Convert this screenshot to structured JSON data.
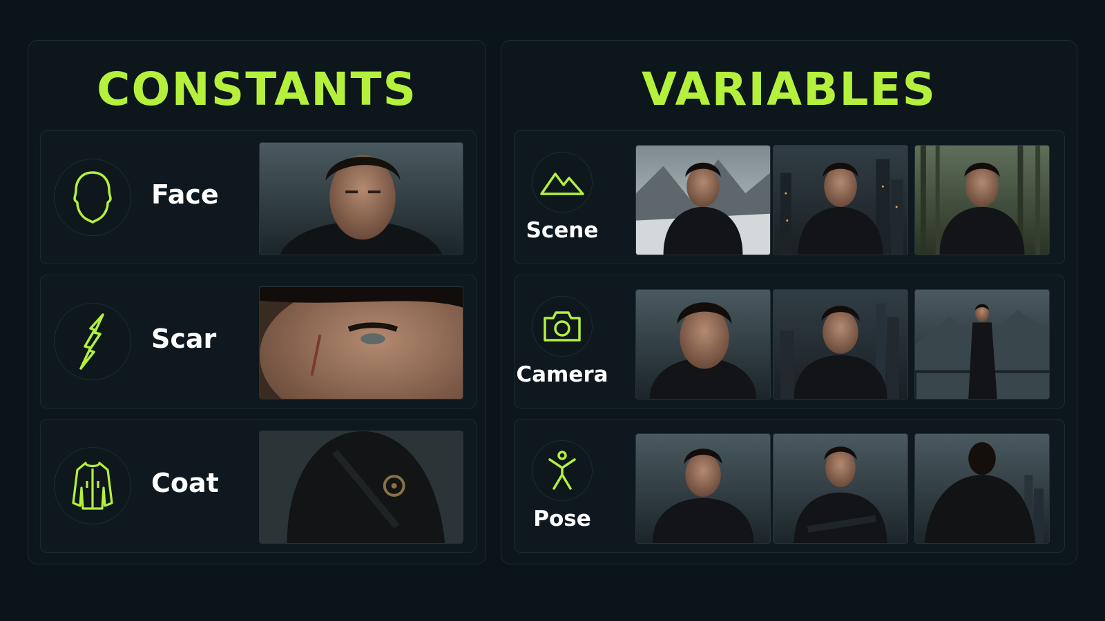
{
  "constants": {
    "title": "CONSTANTS",
    "rows": [
      {
        "label": "Face",
        "icon": "head-outline-icon",
        "photo": "face-portrait"
      },
      {
        "label": "Scar",
        "icon": "scar-lightning-icon",
        "photo": "scar-closeup"
      },
      {
        "label": "Coat",
        "icon": "coat-icon",
        "photo": "coat-brooch-closeup"
      }
    ]
  },
  "variables": {
    "title": "VARIABLES",
    "rows": [
      {
        "label": "Scene",
        "icon": "mountain-icon",
        "photos": [
          "snowy-mountains",
          "night-city",
          "misty-forest"
        ]
      },
      {
        "label": "Camera",
        "icon": "camera-icon",
        "photos": [
          "close-up",
          "medium-shot",
          "wide-shot"
        ]
      },
      {
        "label": "Pose",
        "icon": "person-pose-icon",
        "photos": [
          "three-quarter-pose",
          "arms-crossed-pose",
          "back-view-pose"
        ]
      }
    ]
  },
  "colors": {
    "accent": "#b4f03c",
    "background": "#0b1419",
    "panel_border": "#1d2a30",
    "label_text": "#ffffff"
  }
}
